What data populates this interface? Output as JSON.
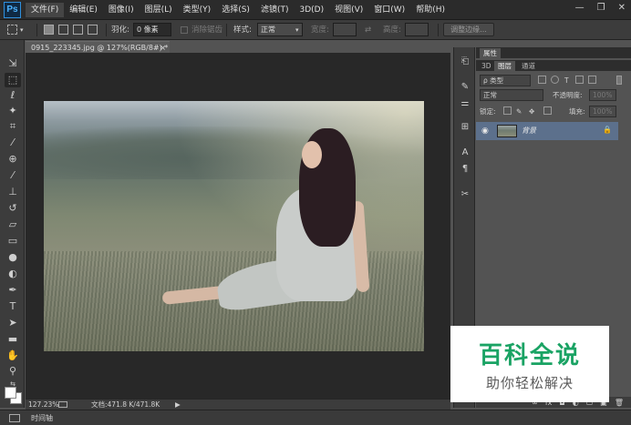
{
  "app": {
    "logo": "Ps"
  },
  "menu": {
    "items": [
      "文件(F)",
      "编辑(E)",
      "图像(I)",
      "图层(L)",
      "类型(Y)",
      "选择(S)",
      "滤镜(T)",
      "3D(D)",
      "视图(V)",
      "窗口(W)",
      "帮助(H)"
    ]
  },
  "window_controls": {
    "minimize": "—",
    "restore": "❐",
    "close": "✕"
  },
  "options": {
    "feather_label": "羽化:",
    "feather_value": "0 像素",
    "antialias_label": "消除锯齿",
    "style_label": "样式:",
    "style_value": "正常",
    "width_label": "宽度:",
    "height_label": "高度:",
    "refine_edge_button": "调整边缘..."
  },
  "document": {
    "tab_title": "0915_223345.jpg @ 127%(RGB/8#) *",
    "close": "×"
  },
  "status": {
    "zoom": "127.23%",
    "doc_size": "文档:471.8 K/471.8K",
    "arrow": "▶"
  },
  "timeline": {
    "label": "时间轴"
  },
  "properties_panel": {
    "tab": "属性"
  },
  "layers_panel": {
    "tabs": [
      "3D",
      "图层",
      "通道"
    ],
    "active_tab": "图层",
    "filter_label": "ρ 类型",
    "blend_mode": "正常",
    "opacity_label": "不透明度:",
    "opacity_value": "100%",
    "lock_label": "锁定:",
    "fill_label": "填充:",
    "fill_value": "100%",
    "layers": [
      {
        "name": "背景",
        "visible": true,
        "locked": true
      }
    ]
  },
  "watermark": {
    "title": "百科全说",
    "subtitle": "助你轻松解决",
    "title_color": "#1aa364"
  },
  "colors": {
    "foreground": "#ffffff",
    "background": "#ffffff",
    "selected_layer": "#5c708c",
    "ui_dark": "#3c3c3c"
  }
}
